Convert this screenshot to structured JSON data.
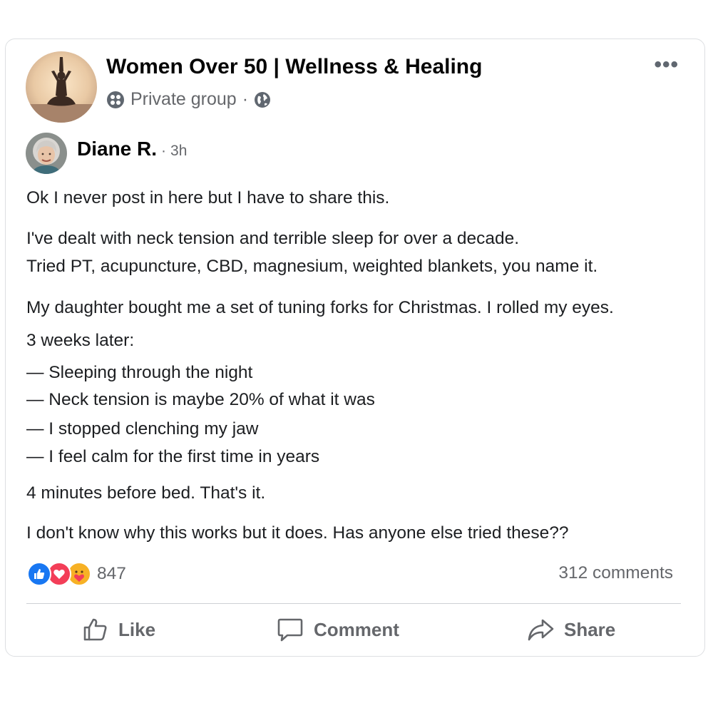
{
  "group": {
    "name": "Women Over 50 | Wellness & Healing",
    "privacy": "Private group",
    "separator": "·"
  },
  "post": {
    "author": "Diane R.",
    "time_separator": "·",
    "time": "3h",
    "lines": [
      "Ok I never post in here but I have to share this.",
      "I've dealt with neck tension and terrible sleep for over a decade.",
      "Tried PT, acupuncture, CBD, magnesium, weighted blankets, you name it.",
      "My daughter bought me a set of tuning forks for Christmas. I rolled my eyes.",
      "3 weeks later:",
      "— Sleeping through the night",
      "— Neck tension is maybe 20% of what it was",
      "— I stopped clenching my jaw",
      "— I feel calm for the first time in years",
      "4 minutes before bed. That's it.",
      "I don't know why this works but it does. Has anyone else tried these??"
    ]
  },
  "stats": {
    "reaction_icons": [
      "like-icon",
      "love-icon",
      "care-icon"
    ],
    "reaction_count": "847",
    "comments": "312 comments"
  },
  "actions": {
    "like": "Like",
    "comment": "Comment",
    "share": "Share"
  },
  "colors": {
    "like_blue": "#1877f2",
    "love_red": "#f33e58",
    "care_yellow": "#f7b125",
    "secondary_text": "#65676b"
  }
}
